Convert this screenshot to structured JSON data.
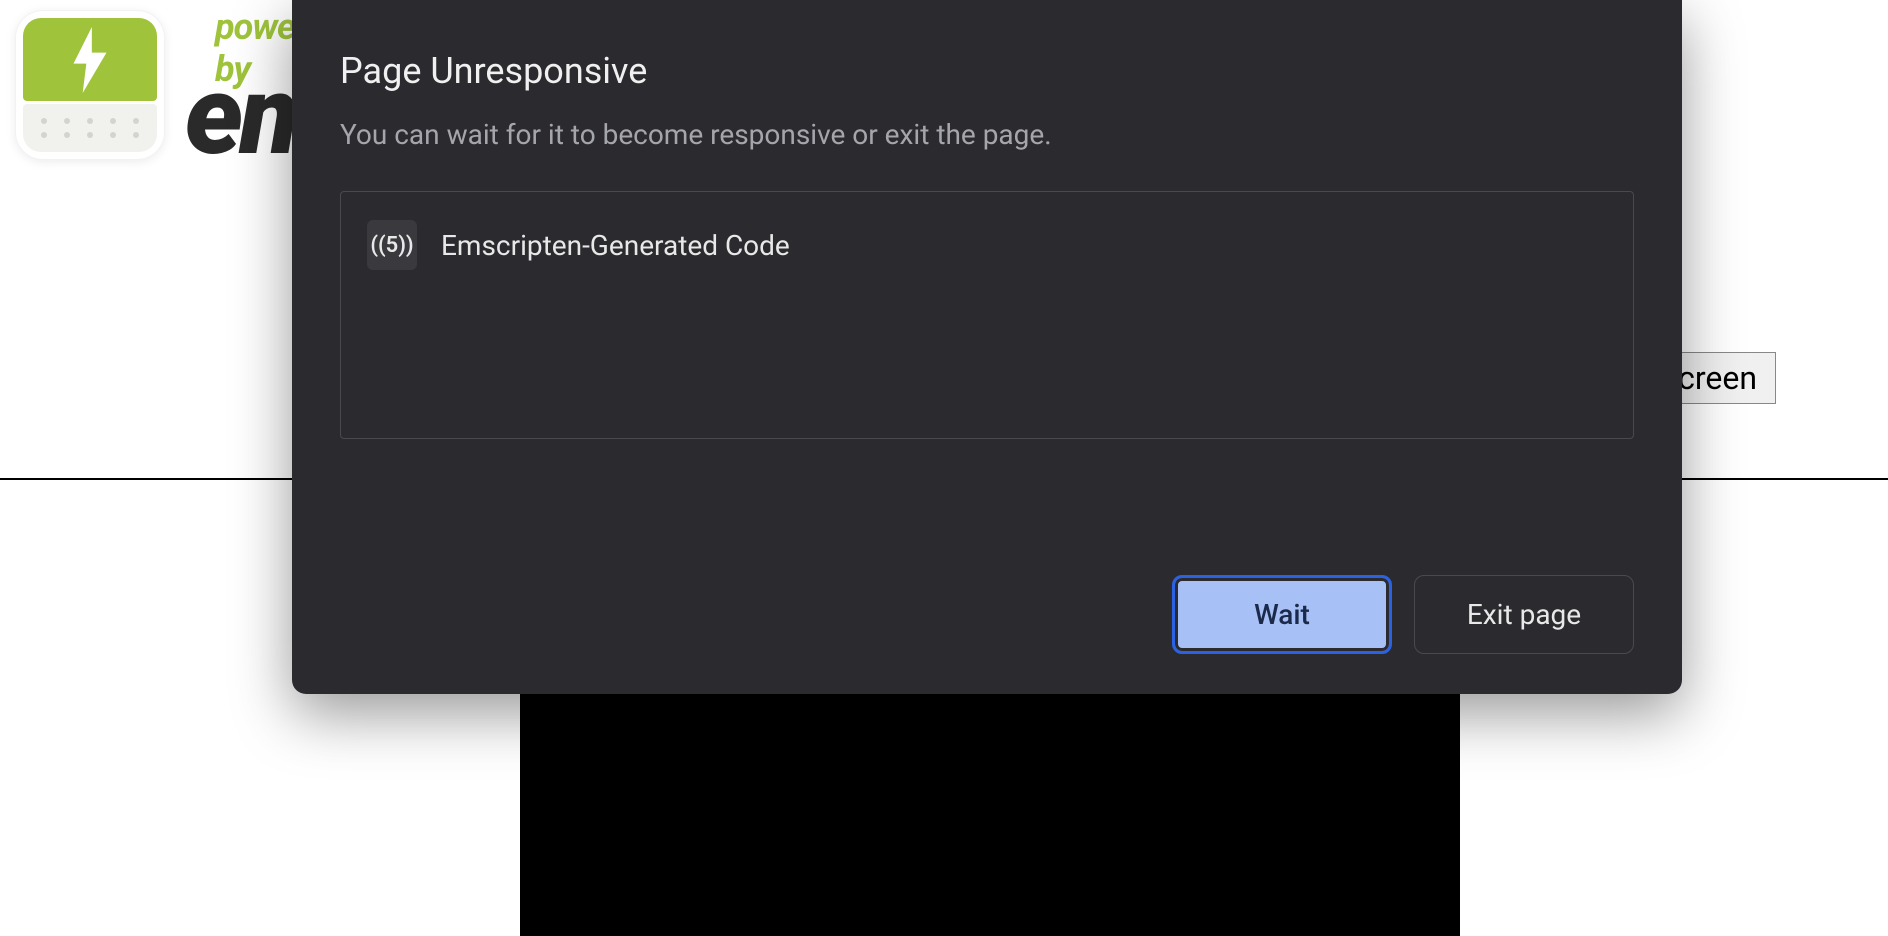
{
  "page": {
    "wordmark_sub": "powered by",
    "wordmark_main": "emscripten",
    "fullscreen_label": "Fullscreen"
  },
  "modal": {
    "title": "Page Unresponsive",
    "description": "You can wait for it to become responsive or exit the page.",
    "process": {
      "icon_text": "((5))",
      "label": "Emscripten-Generated Code"
    },
    "actions": {
      "wait_label": "Wait",
      "exit_label": "Exit page"
    }
  }
}
